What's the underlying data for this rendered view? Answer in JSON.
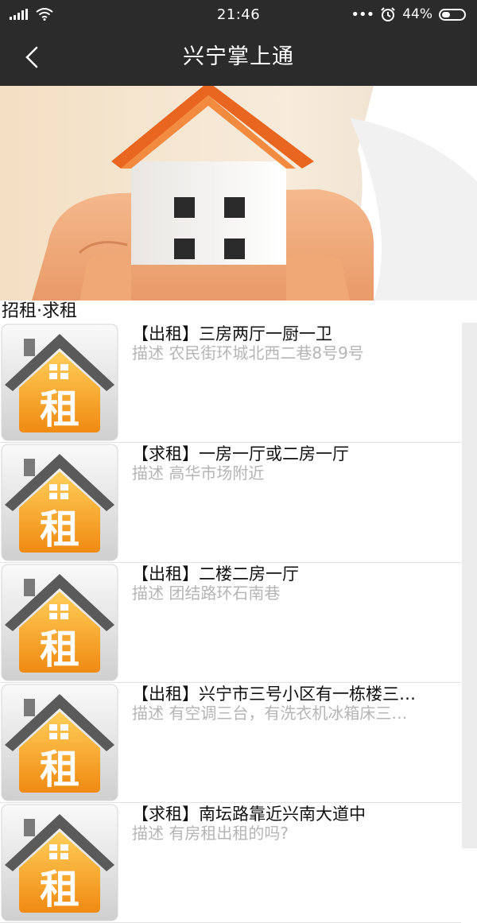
{
  "status_bar": {
    "time": "21:46",
    "battery": "44%",
    "more_icon": "more-dots-icon",
    "alarm_icon": "alarm-icon"
  },
  "header": {
    "title": "兴宁掌上通",
    "back_icon": "chevron-left-icon"
  },
  "banner": {
    "subject": "hands holding house model"
  },
  "section": {
    "title": "招租·求租"
  },
  "desc_prefix": "描述",
  "listings": [
    {
      "title": "【出租】三房两厅一厨一卫",
      "desc": "描述 农民街环城北西二巷8号9号"
    },
    {
      "title": "【求租】一房一厅或二房一厅",
      "desc": "描述 高华市场附近"
    },
    {
      "title": "【出租】二楼二房一厅",
      "desc": "描述 团结路环石南巷"
    },
    {
      "title": "【出租】兴宁市三号小区有一栋楼三…",
      "desc": "描述 有空调三台，有洗衣机冰箱床三…"
    },
    {
      "title": "【求租】南坛路靠近兴南大道中",
      "desc": "描述 有房租出租的吗?"
    }
  ],
  "thumb_glyph": "租",
  "colors": {
    "bar_bg": "#2b2b2b",
    "roof_orange": "#e8661f",
    "thumb_orange": "#f08a12",
    "desc_gray": "#b5b5b5"
  }
}
